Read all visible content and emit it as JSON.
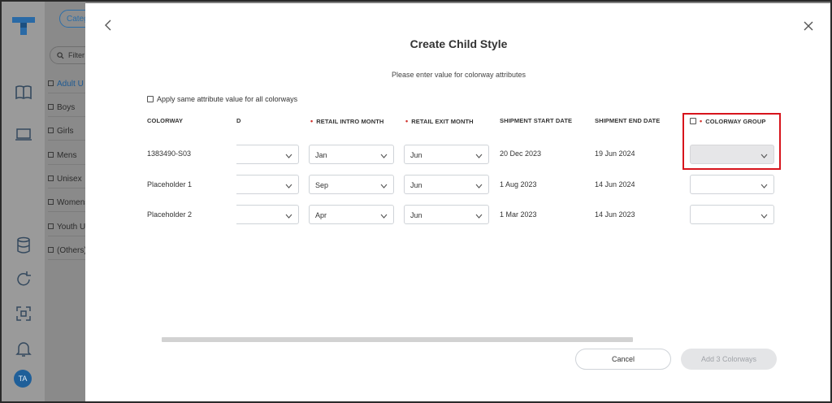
{
  "sidebar": {
    "category_pill": "Categ",
    "filter_placeholder": "Filter",
    "tree": [
      "Adult U",
      "Boys",
      "Girls",
      "Mens",
      "Unisex",
      "Womens",
      "Youth U",
      "(Others)"
    ],
    "avatar_initials": "TA"
  },
  "modal": {
    "title": "Create Child Style",
    "subtitle": "Please enter value for colorway attributes",
    "apply_all_label": "Apply same attribute value for all colorways",
    "headers": {
      "colorway": "COLORWAY",
      "partial": "D",
      "retail_intro": "RETAIL INTRO MONTH",
      "retail_exit": "RETAIL EXIT MONTH",
      "ship_start": "SHIPMENT START DATE",
      "ship_end": "SHIPMENT END DATE",
      "colorway_group": "COLORWAY GROUP"
    },
    "rows": [
      {
        "colorway": "1383490-S03",
        "intro": "Jan",
        "exit": "Jun",
        "ship_start": "20 Dec 2023",
        "ship_end": "19 Jun 2024",
        "group": ""
      },
      {
        "colorway": "Placeholder 1",
        "intro": "Sep",
        "exit": "Jun",
        "ship_start": "1 Aug 2023",
        "ship_end": "14 Jun 2024",
        "group": ""
      },
      {
        "colorway": "Placeholder 2",
        "intro": "Apr",
        "exit": "Jun",
        "ship_start": "1 Mar 2023",
        "ship_end": "14 Jun 2023",
        "group": ""
      }
    ],
    "cancel_label": "Cancel",
    "add_label": "Add 3 Colorways"
  },
  "colors": {
    "required": "#d0302b",
    "highlight": "#d7141c",
    "brand": "#1f5f99"
  }
}
